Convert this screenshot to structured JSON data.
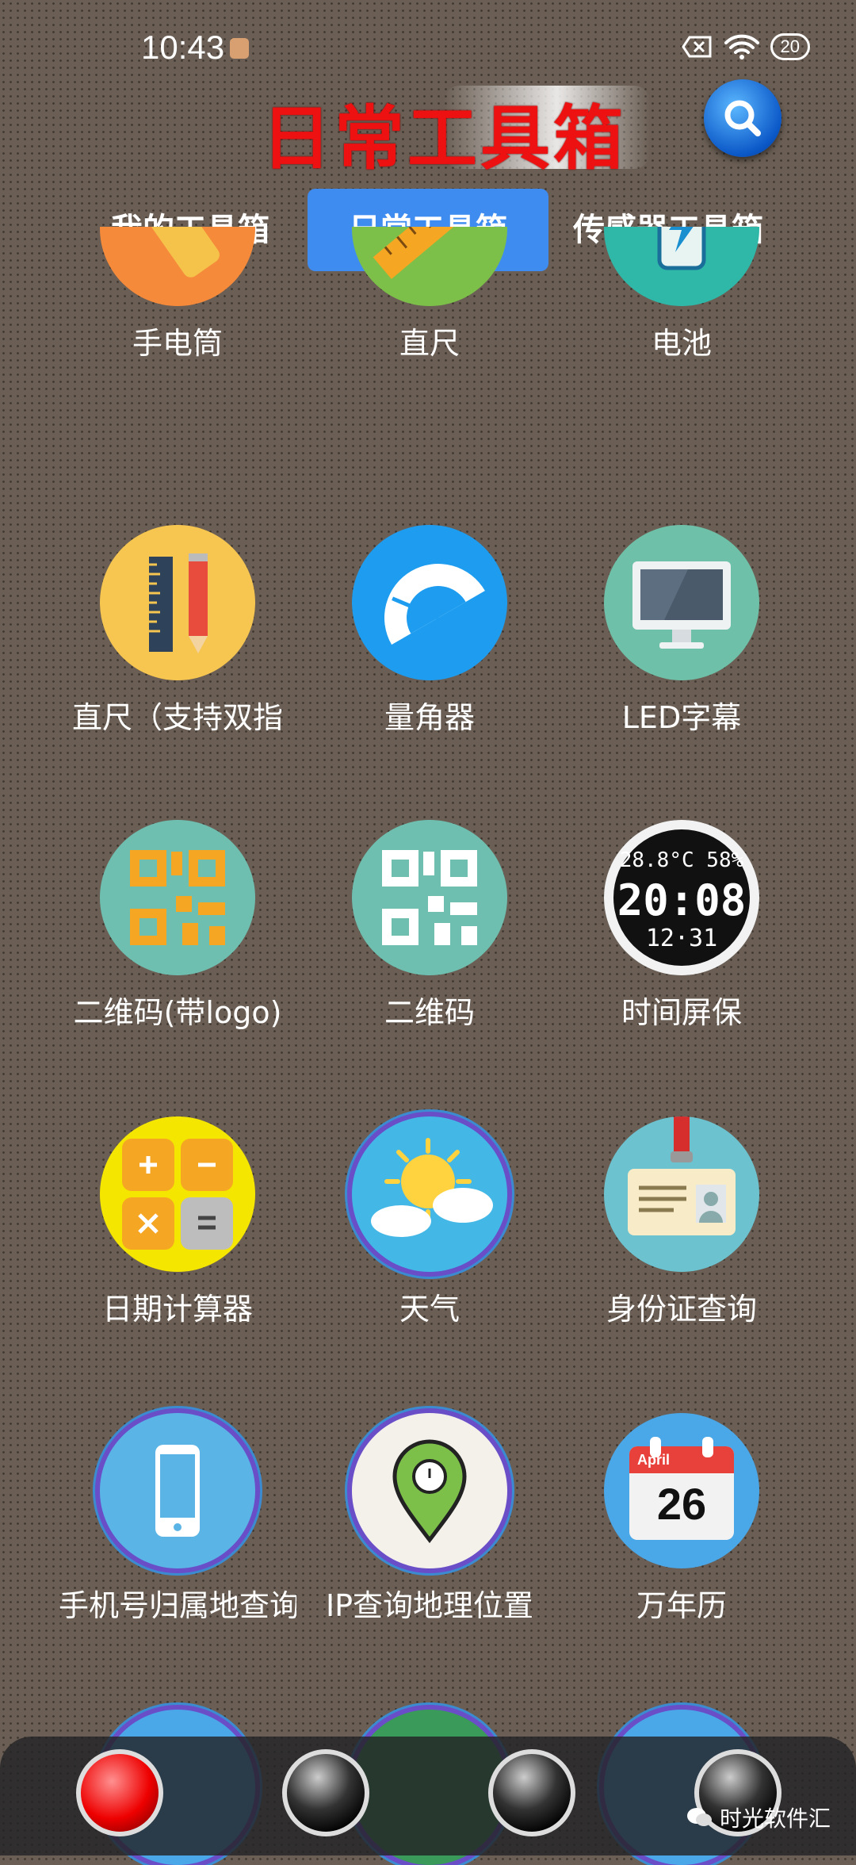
{
  "status_bar": {
    "time": "10:43",
    "battery": "20"
  },
  "header": {
    "title": "日常工具箱"
  },
  "tabs": [
    {
      "label": "我的工具箱",
      "active": false
    },
    {
      "label": "日常工具箱",
      "active": true
    },
    {
      "label": "传感器工具箱",
      "active": false
    }
  ],
  "tools": [
    {
      "label": "手电筒",
      "icon": "flashlight-icon",
      "color": "#f58a3b"
    },
    {
      "label": "直尺",
      "icon": "ruler-icon",
      "color": "#7cc04a"
    },
    {
      "label": "电池",
      "icon": "battery-icon",
      "color": "#2fb8a8"
    },
    {
      "label": "直尺（支持双指",
      "icon": "ruler-pencil-icon",
      "color": "#f7c650"
    },
    {
      "label": "量角器",
      "icon": "protractor-icon",
      "color": "#1e9df0"
    },
    {
      "label": "LED字幕",
      "icon": "monitor-icon",
      "color": "#6fc0a8"
    },
    {
      "label": "二维码(带logo)",
      "icon": "qr-logo-icon",
      "color": "#6fbfb0"
    },
    {
      "label": "二维码",
      "icon": "qr-code-icon",
      "color": "#6fbfb0"
    },
    {
      "label": "时间屏保",
      "icon": "digital-clock-icon",
      "color": "#111111",
      "clock": {
        "top": "28.8°C 58%",
        "time": "20:08",
        "date": "12·31"
      }
    },
    {
      "label": "日期计算器",
      "icon": "calculator-icon",
      "color": "#f5e600"
    },
    {
      "label": "天气",
      "icon": "weather-icon",
      "color": "#43b7e6"
    },
    {
      "label": "身份证查询",
      "icon": "id-card-icon",
      "color": "#6cc2ce"
    },
    {
      "label": "手机号归属地查询",
      "icon": "phone-icon",
      "color": "#5ab4e6"
    },
    {
      "label": "IP查询地理位置",
      "icon": "location-pin-icon",
      "color": "#f3f1ea"
    },
    {
      "label": "万年历",
      "icon": "calendar-icon",
      "color": "#4aa7e8",
      "calendar": {
        "month": "April",
        "day": "26"
      }
    }
  ],
  "dock": {
    "buttons": [
      "red-orb",
      "black-orb",
      "black-orb",
      "black-orb"
    ]
  },
  "watermark": {
    "text": "时光软件汇"
  }
}
